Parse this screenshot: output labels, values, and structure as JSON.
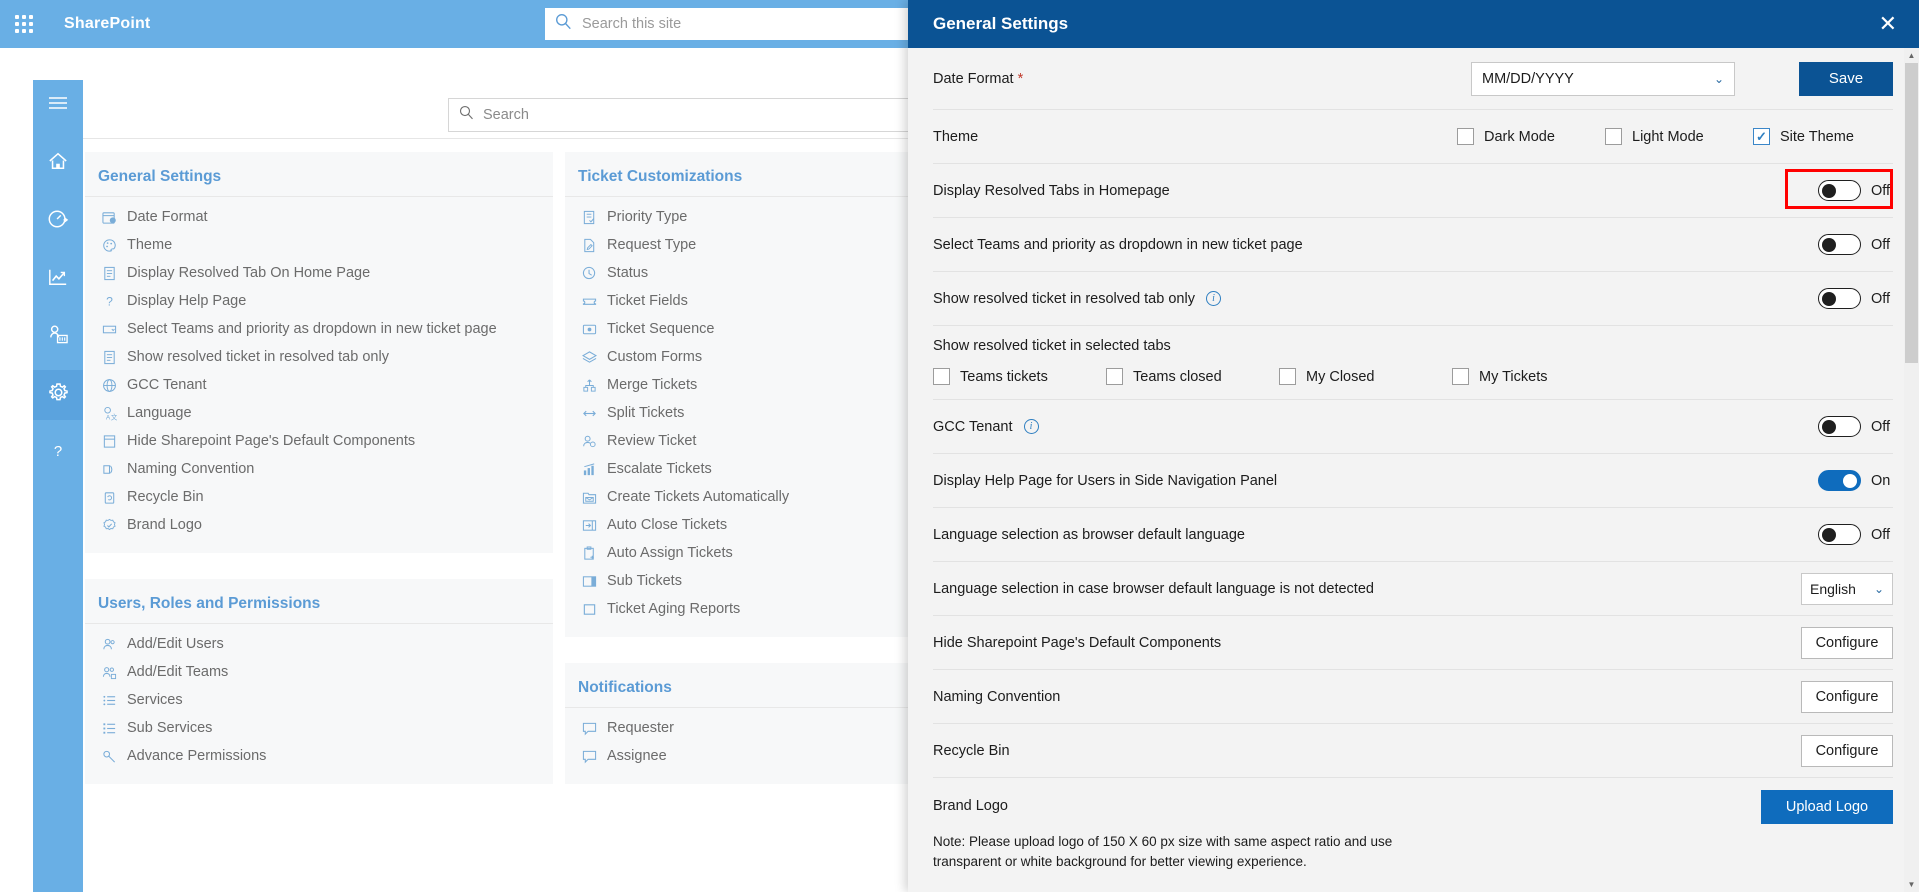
{
  "suite": {
    "title": "SharePoint",
    "search_placeholder": "Search this site",
    "waffle_icon": "app-launcher-icon",
    "search_icon": "search-icon"
  },
  "site": {
    "search_placeholder": "Search",
    "search_icon": "search-icon"
  },
  "rail": [
    {
      "name": "hamburger-icon",
      "label": "Menu"
    },
    {
      "name": "home-icon",
      "label": "Home"
    },
    {
      "name": "dashboard-icon",
      "label": "Dashboard"
    },
    {
      "name": "analytics-icon",
      "label": "Reports"
    },
    {
      "name": "teams-icon",
      "label": "Teams"
    },
    {
      "name": "settings-gear-icon",
      "label": "Settings"
    },
    {
      "name": "help-question-icon",
      "label": "Help"
    }
  ],
  "columns": {
    "col1": [
      {
        "title": "General Settings",
        "items": [
          {
            "label": "Date Format",
            "icon": "calendar-clock-icon"
          },
          {
            "label": "Theme",
            "icon": "palette-icon"
          },
          {
            "label": "Display Resolved Tab On Home Page",
            "icon": "document-icon"
          },
          {
            "label": "Display Help Page",
            "icon": "question-icon"
          },
          {
            "label": "Select Teams and priority as dropdown in new ticket page",
            "icon": "dropdown-icon"
          },
          {
            "label": "Show resolved ticket in resolved tab only",
            "icon": "document-icon"
          },
          {
            "label": "GCC Tenant",
            "icon": "globe-icon"
          },
          {
            "label": "Language",
            "icon": "translate-icon"
          },
          {
            "label": "Hide Sharepoint Page's Default Components",
            "icon": "page-layout-icon"
          },
          {
            "label": "Naming Convention",
            "icon": "rename-icon"
          },
          {
            "label": "Recycle Bin",
            "icon": "recycle-bin-icon"
          },
          {
            "label": "Brand Logo",
            "icon": "badge-icon"
          }
        ]
      },
      {
        "title": "Users, Roles and Permissions",
        "items": [
          {
            "label": "Add/Edit Users",
            "icon": "people-icon"
          },
          {
            "label": "Add/Edit Teams",
            "icon": "team-add-icon"
          },
          {
            "label": "Services",
            "icon": "list-icon"
          },
          {
            "label": "Sub Services",
            "icon": "sub-list-icon"
          },
          {
            "label": "Advance Permissions",
            "icon": "key-icon"
          }
        ]
      }
    ],
    "col2": [
      {
        "title": "Ticket Customizations",
        "items": [
          {
            "label": "Priority Type",
            "icon": "priority-list-icon"
          },
          {
            "label": "Request Type",
            "icon": "request-edit-icon"
          },
          {
            "label": "Status",
            "icon": "clock-check-icon"
          },
          {
            "label": "Ticket Fields",
            "icon": "ticket-icon"
          },
          {
            "label": "Ticket Sequence",
            "icon": "sequence-icon"
          },
          {
            "label": "Custom Forms",
            "icon": "layers-icon"
          },
          {
            "label": "Merge Tickets",
            "icon": "merge-icon"
          },
          {
            "label": "Split Tickets",
            "icon": "split-arrows-icon"
          },
          {
            "label": "Review Ticket",
            "icon": "person-review-icon"
          },
          {
            "label": "Escalate Tickets",
            "icon": "escalate-chart-icon"
          },
          {
            "label": "Create Tickets Automatically",
            "icon": "mail-folder-icon"
          },
          {
            "label": "Auto Close Tickets",
            "icon": "close-arrow-icon"
          },
          {
            "label": "Auto Assign Tickets",
            "icon": "clipboard-arrow-icon"
          },
          {
            "label": "Sub Tickets",
            "icon": "columns-icon"
          },
          {
            "label": "Ticket Aging Reports",
            "icon": "square-icon"
          }
        ]
      },
      {
        "title": "Notifications",
        "items": [
          {
            "label": "Requester",
            "icon": "comment-icon"
          },
          {
            "label": "Assignee",
            "icon": "comment-icon"
          }
        ]
      }
    ]
  },
  "panel": {
    "title": "General Settings",
    "close_icon": "close-icon",
    "date_format": {
      "label": "Date Format",
      "required_mark": "*",
      "value": "MM/DD/YYYY",
      "chevron": "chevron-down-icon"
    },
    "save_label": "Save",
    "theme": {
      "label": "Theme",
      "options": [
        {
          "label": "Dark Mode",
          "checked": false
        },
        {
          "label": "Light Mode",
          "checked": false
        },
        {
          "label": "Site Theme",
          "checked": true
        }
      ]
    },
    "rows": [
      {
        "label": "Display Resolved Tabs in Homepage",
        "state": "Off",
        "on": false
      },
      {
        "label": "Select Teams and priority as dropdown in new ticket page",
        "state": "Off",
        "on": false,
        "highlighted": true
      },
      {
        "label": "Show resolved ticket in resolved tab only",
        "state": "Off",
        "on": false,
        "info": true
      }
    ],
    "selected_tabs": {
      "caption": "Show resolved ticket in selected tabs",
      "options": [
        {
          "label": "Teams tickets",
          "checked": false
        },
        {
          "label": "Teams closed",
          "checked": false
        },
        {
          "label": "My Closed",
          "checked": false
        },
        {
          "label": "My Tickets",
          "checked": false
        }
      ]
    },
    "gcc": {
      "label": "GCC Tenant",
      "state": "Off",
      "on": false,
      "info": true
    },
    "help_page": {
      "label": "Display Help Page for Users in Side Navigation Panel",
      "state": "On",
      "on": true
    },
    "lang_browser": {
      "label": "Language selection as browser default language",
      "state": "Off",
      "on": false
    },
    "lang_fallback": {
      "label": "Language selection in case browser default language is not detected",
      "value": "English",
      "chevron": "chevron-down-icon"
    },
    "hide_components": {
      "label": "Hide Sharepoint Page's Default Components",
      "button": "Configure"
    },
    "naming": {
      "label": "Naming Convention",
      "button": "Configure"
    },
    "recycle": {
      "label": "Recycle Bin",
      "button": "Configure"
    },
    "brand_logo": {
      "label": "Brand Logo",
      "button": "Upload Logo",
      "note": "Note: Please upload logo of 150 X 60 px size with same aspect ratio and use transparent or white background for better viewing experience."
    },
    "scrollbar": {
      "up": "▲",
      "down": "▼"
    }
  },
  "colors": {
    "suitebar": "#69afe5",
    "panel_header": "#0b5394",
    "accent": "#0f6cbd",
    "highlight": "#ff0000",
    "section_title": "#5b9bd5"
  }
}
